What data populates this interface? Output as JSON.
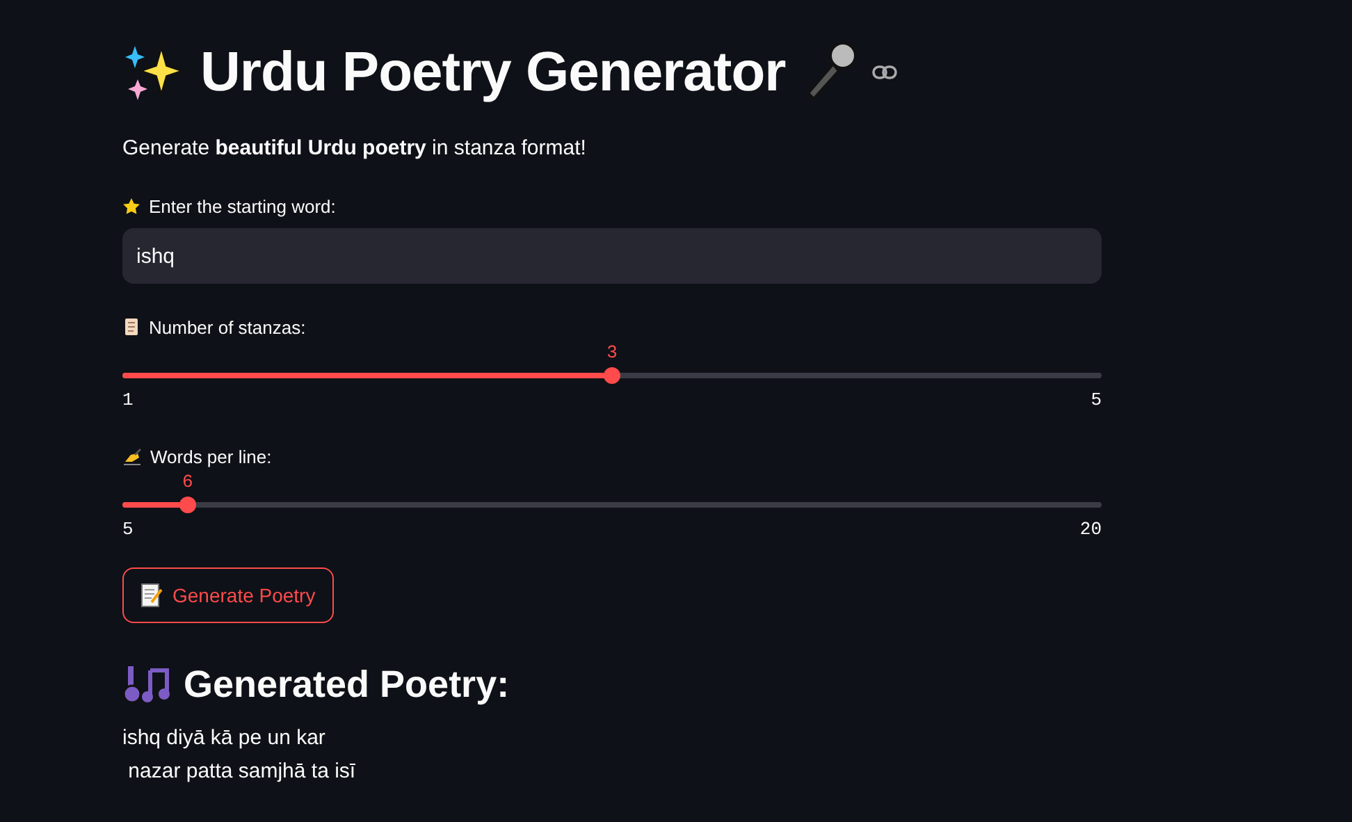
{
  "title": "Urdu Poetry Generator",
  "subtitle": "Generate **beautiful Urdu poetry** in stanza format!",
  "word_input": {
    "label": "Enter the starting word:",
    "value": "ishq"
  },
  "sliders": [
    {
      "label": "Number of stanzas:",
      "reading": "3",
      "min": "1",
      "max": "5",
      "level": 0.5
    },
    {
      "label": "Words per line:",
      "reading": "6",
      "min": "5",
      "max": "20",
      "level": 0.0667
    }
  ],
  "button": {
    "label": "Generate Poetry"
  },
  "output": {
    "heading": "Generated Poetry:",
    "lines": [
      "ishq diyā kā pe un kar",
      "nazar patta samjhā ta isī"
    ]
  }
}
